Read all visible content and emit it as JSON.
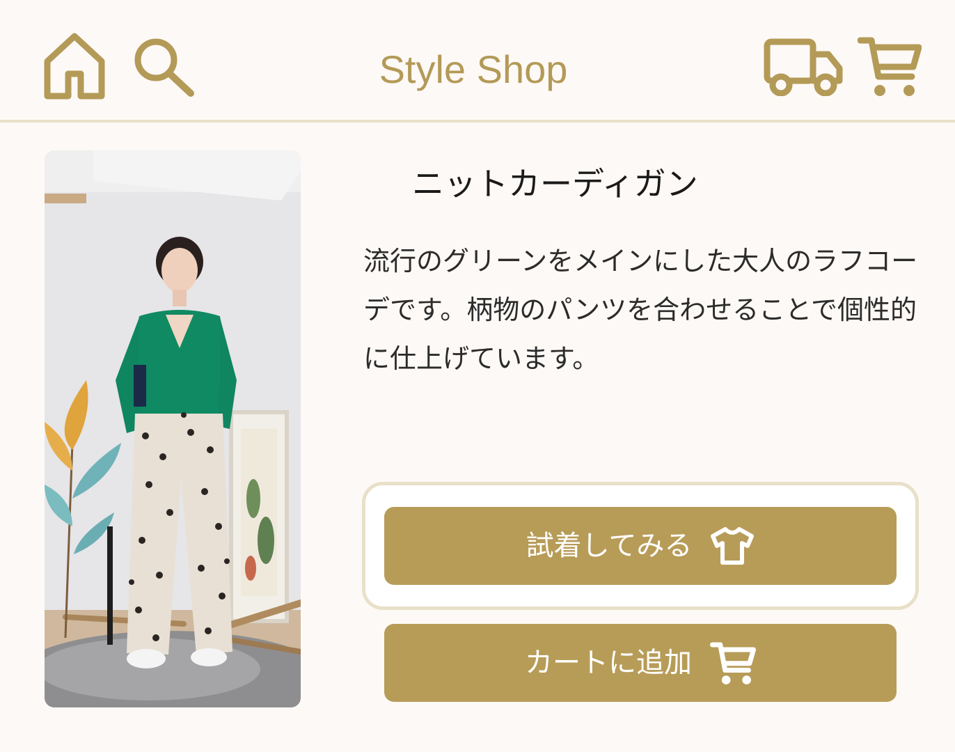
{
  "header": {
    "title": "Style Shop",
    "icons": {
      "home": "home-icon",
      "search": "search-icon",
      "shipping": "truck-icon",
      "cart": "cart-icon"
    }
  },
  "product": {
    "name": "ニットカーディガン",
    "description": "流行のグリーンをメインにした大人のラフコーデです。柄物のパンツを合わせることで個性的に仕上げています。",
    "image_icon": "product-photo"
  },
  "actions": {
    "try_on_label": "試着してみる",
    "try_on_icon": "tshirt-icon",
    "add_to_cart_label": "カートに追加",
    "add_to_cart_icon": "cart-icon"
  },
  "colors": {
    "accent": "#b79c58",
    "header_divider": "#e8e0c8",
    "background": "#fdf9f6",
    "button_text": "#ffffff"
  }
}
